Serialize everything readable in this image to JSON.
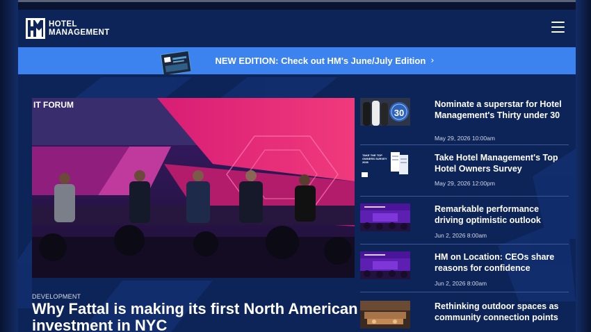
{
  "logo": {
    "line1": "HOTEL",
    "line2": "MANAGEMENT"
  },
  "header": {
    "menu_icon": "hamburger-menu-icon"
  },
  "banner": {
    "text": "NEW EDITION: Check out HM's June/July Edition",
    "chevron": "›",
    "thumb_icon": "magazine-cover-thumbnail"
  },
  "hero": {
    "image_label": "IT FORUM",
    "category": "DEVELOPMENT",
    "title": "Why Fattal is making its first North American investment in NYC"
  },
  "sidebar": {
    "items": [
      {
        "title": "Nominate a superstar for Hotel Management's Thirty under 30",
        "date": "May 29, 2026 10:00am",
        "thumb_label": "30"
      },
      {
        "title": "Take Hotel Management's Top Hotel Owners Survey",
        "date": "May 29, 2026 12:00pm",
        "thumb_label": "TAKE THE TOP OWNERS SURVEY 2026"
      },
      {
        "title": "Remarkable performance driving optimistic outlook",
        "date": "Jun 2, 2026 8:00am"
      },
      {
        "title": "HM on Location: CEOs share reasons for confidence",
        "date": "Jun 2, 2026 8:00am"
      },
      {
        "title": "Rethinking outdoor spaces as community connection points",
        "date": ""
      }
    ]
  },
  "colors": {
    "navy": "#0d2459",
    "banner_blue": "#3d83f0",
    "hero_magenta": "#e0206e",
    "hero_purple": "#3b1f6b"
  }
}
